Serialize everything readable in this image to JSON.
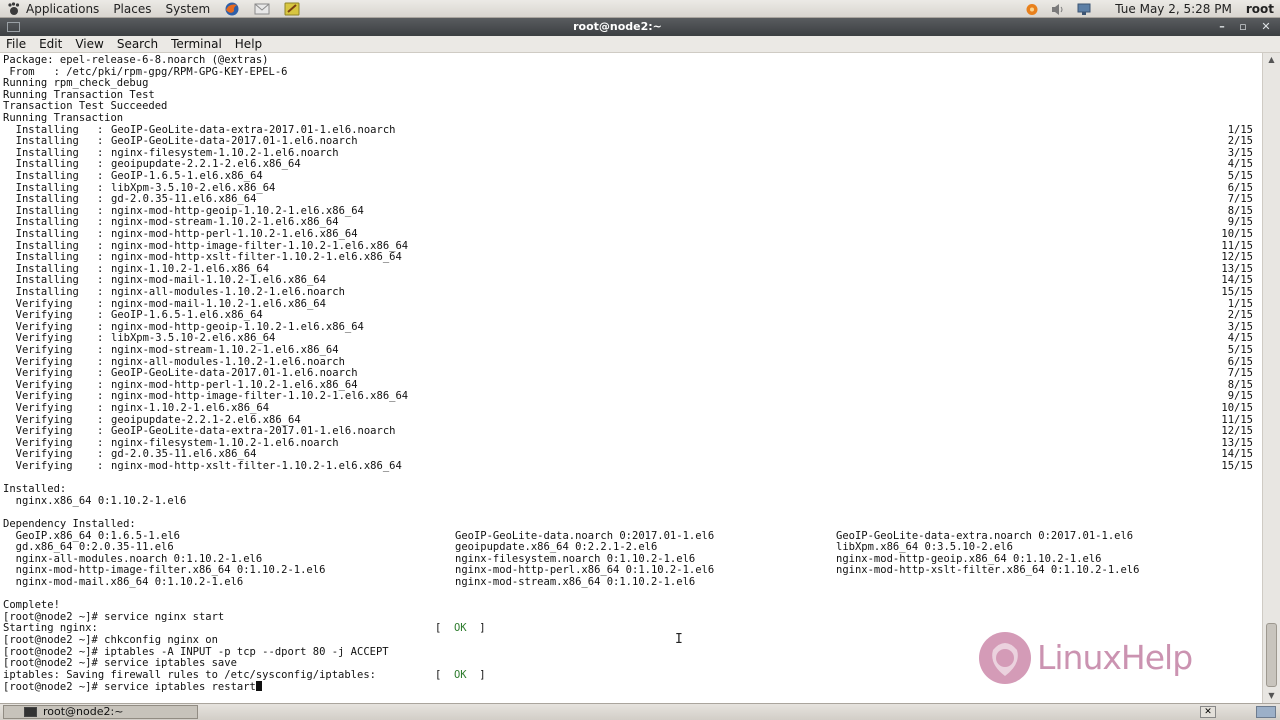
{
  "top_panel": {
    "menus": [
      "Applications",
      "Places",
      "System"
    ],
    "clock": "Tue May 2,  5:28 PM",
    "user": "root",
    "colors": {
      "firefox": "#e66a1f",
      "mail": "#b8b8b8",
      "notes": "#d8c640",
      "update": "#e8801c",
      "volume": "#7a7a7a",
      "network": "#5c7fa6"
    }
  },
  "window": {
    "title": "root@node2:~",
    "min_glyph": "–",
    "max_glyph": "▫",
    "close_glyph": "✕"
  },
  "menubar": {
    "items": [
      "File",
      "Edit",
      "View",
      "Search",
      "Terminal",
      "Help"
    ]
  },
  "terminal": {
    "lines": [
      "Package: epel-release-6-8.noarch (@extras)",
      " From   : /etc/pki/rpm-gpg/RPM-GPG-KEY-EPEL-6",
      "Running rpm_check_debug",
      "Running Transaction Test",
      "Transaction Test Succeeded",
      "Running Transaction"
    ],
    "transactions": [
      {
        "action": "  Installing",
        "pkg": "GeoIP-GeoLite-data-extra-2017.01-1.el6.noarch",
        "count": "1/15"
      },
      {
        "action": "  Installing",
        "pkg": "GeoIP-GeoLite-data-2017.01-1.el6.noarch",
        "count": "2/15"
      },
      {
        "action": "  Installing",
        "pkg": "nginx-filesystem-1.10.2-1.el6.noarch",
        "count": "3/15"
      },
      {
        "action": "  Installing",
        "pkg": "geoipupdate-2.2.1-2.el6.x86_64",
        "count": "4/15"
      },
      {
        "action": "  Installing",
        "pkg": "GeoIP-1.6.5-1.el6.x86_64",
        "count": "5/15"
      },
      {
        "action": "  Installing",
        "pkg": "libXpm-3.5.10-2.el6.x86_64",
        "count": "6/15"
      },
      {
        "action": "  Installing",
        "pkg": "gd-2.0.35-11.el6.x86_64",
        "count": "7/15"
      },
      {
        "action": "  Installing",
        "pkg": "nginx-mod-http-geoip-1.10.2-1.el6.x86_64",
        "count": "8/15"
      },
      {
        "action": "  Installing",
        "pkg": "nginx-mod-stream-1.10.2-1.el6.x86_64",
        "count": "9/15"
      },
      {
        "action": "  Installing",
        "pkg": "nginx-mod-http-perl-1.10.2-1.el6.x86_64",
        "count": "10/15"
      },
      {
        "action": "  Installing",
        "pkg": "nginx-mod-http-image-filter-1.10.2-1.el6.x86_64",
        "count": "11/15"
      },
      {
        "action": "  Installing",
        "pkg": "nginx-mod-http-xslt-filter-1.10.2-1.el6.x86_64",
        "count": "12/15"
      },
      {
        "action": "  Installing",
        "pkg": "nginx-1.10.2-1.el6.x86_64",
        "count": "13/15"
      },
      {
        "action": "  Installing",
        "pkg": "nginx-mod-mail-1.10.2-1.el6.x86_64",
        "count": "14/15"
      },
      {
        "action": "  Installing",
        "pkg": "nginx-all-modules-1.10.2-1.el6.noarch",
        "count": "15/15"
      },
      {
        "action": "  Verifying ",
        "pkg": "nginx-mod-mail-1.10.2-1.el6.x86_64",
        "count": "1/15"
      },
      {
        "action": "  Verifying ",
        "pkg": "GeoIP-1.6.5-1.el6.x86_64",
        "count": "2/15"
      },
      {
        "action": "  Verifying ",
        "pkg": "nginx-mod-http-geoip-1.10.2-1.el6.x86_64",
        "count": "3/15"
      },
      {
        "action": "  Verifying ",
        "pkg": "libXpm-3.5.10-2.el6.x86_64",
        "count": "4/15"
      },
      {
        "action": "  Verifying ",
        "pkg": "nginx-mod-stream-1.10.2-1.el6.x86_64",
        "count": "5/15"
      },
      {
        "action": "  Verifying ",
        "pkg": "nginx-all-modules-1.10.2-1.el6.noarch",
        "count": "6/15"
      },
      {
        "action": "  Verifying ",
        "pkg": "GeoIP-GeoLite-data-2017.01-1.el6.noarch",
        "count": "7/15"
      },
      {
        "action": "  Verifying ",
        "pkg": "nginx-mod-http-perl-1.10.2-1.el6.x86_64",
        "count": "8/15"
      },
      {
        "action": "  Verifying ",
        "pkg": "nginx-mod-http-image-filter-1.10.2-1.el6.x86_64",
        "count": "9/15"
      },
      {
        "action": "  Verifying ",
        "pkg": "nginx-1.10.2-1.el6.x86_64",
        "count": "10/15"
      },
      {
        "action": "  Verifying ",
        "pkg": "geoipupdate-2.2.1-2.el6.x86_64",
        "count": "11/15"
      },
      {
        "action": "  Verifying ",
        "pkg": "GeoIP-GeoLite-data-extra-2017.01-1.el6.noarch",
        "count": "12/15"
      },
      {
        "action": "  Verifying ",
        "pkg": "nginx-filesystem-1.10.2-1.el6.noarch",
        "count": "13/15"
      },
      {
        "action": "  Verifying ",
        "pkg": "gd-2.0.35-11.el6.x86_64",
        "count": "14/15"
      },
      {
        "action": "  Verifying ",
        "pkg": "nginx-mod-http-xslt-filter-1.10.2-1.el6.x86_64",
        "count": "15/15"
      }
    ],
    "installed_header": "Installed:",
    "installed": "  nginx.x86_64 0:1.10.2-1.el6",
    "dependency_header": "Dependency Installed:",
    "dependencies": [
      [
        "  GeoIP.x86_64 0:1.6.5-1.el6",
        "GeoIP-GeoLite-data.noarch 0:2017.01-1.el6",
        "GeoIP-GeoLite-data-extra.noarch 0:2017.01-1.el6"
      ],
      [
        "  gd.x86_64 0:2.0.35-11.el6",
        "geoipupdate.x86_64 0:2.2.1-2.el6",
        "libXpm.x86_64 0:3.5.10-2.el6"
      ],
      [
        "  nginx-all-modules.noarch 0:1.10.2-1.el6",
        "nginx-filesystem.noarch 0:1.10.2-1.el6",
        "nginx-mod-http-geoip.x86_64 0:1.10.2-1.el6"
      ],
      [
        "  nginx-mod-http-image-filter.x86_64 0:1.10.2-1.el6",
        "nginx-mod-http-perl.x86_64 0:1.10.2-1.el6",
        "nginx-mod-http-xslt-filter.x86_64 0:1.10.2-1.el6"
      ],
      [
        "  nginx-mod-mail.x86_64 0:1.10.2-1.el6",
        "nginx-mod-stream.x86_64 0:1.10.2-1.el6",
        ""
      ]
    ],
    "complete": "Complete!",
    "session": [
      {
        "text": "[root@node2 ~]# service nginx start",
        "status": ""
      },
      {
        "text": "Starting nginx:",
        "status": "[  OK  ]"
      },
      {
        "text": "[root@node2 ~]# chkconfig nginx on",
        "status": ""
      },
      {
        "text": "[root@node2 ~]# iptables -A INPUT -p tcp --dport 80 -j ACCEPT",
        "status": ""
      },
      {
        "text": "[root@node2 ~]# service iptables save",
        "status": ""
      },
      {
        "text": "iptables: Saving firewall rules to /etc/sysconfig/iptables:",
        "status": "[  OK  ]"
      },
      {
        "text": "[root@node2 ~]# service iptables restart",
        "status": ""
      }
    ],
    "ok_color": "#2f7d2f"
  },
  "watermark": {
    "text": "LinuxHelp",
    "color": "#ba6f97"
  },
  "taskbar": {
    "task_label": "root@node2:~"
  }
}
